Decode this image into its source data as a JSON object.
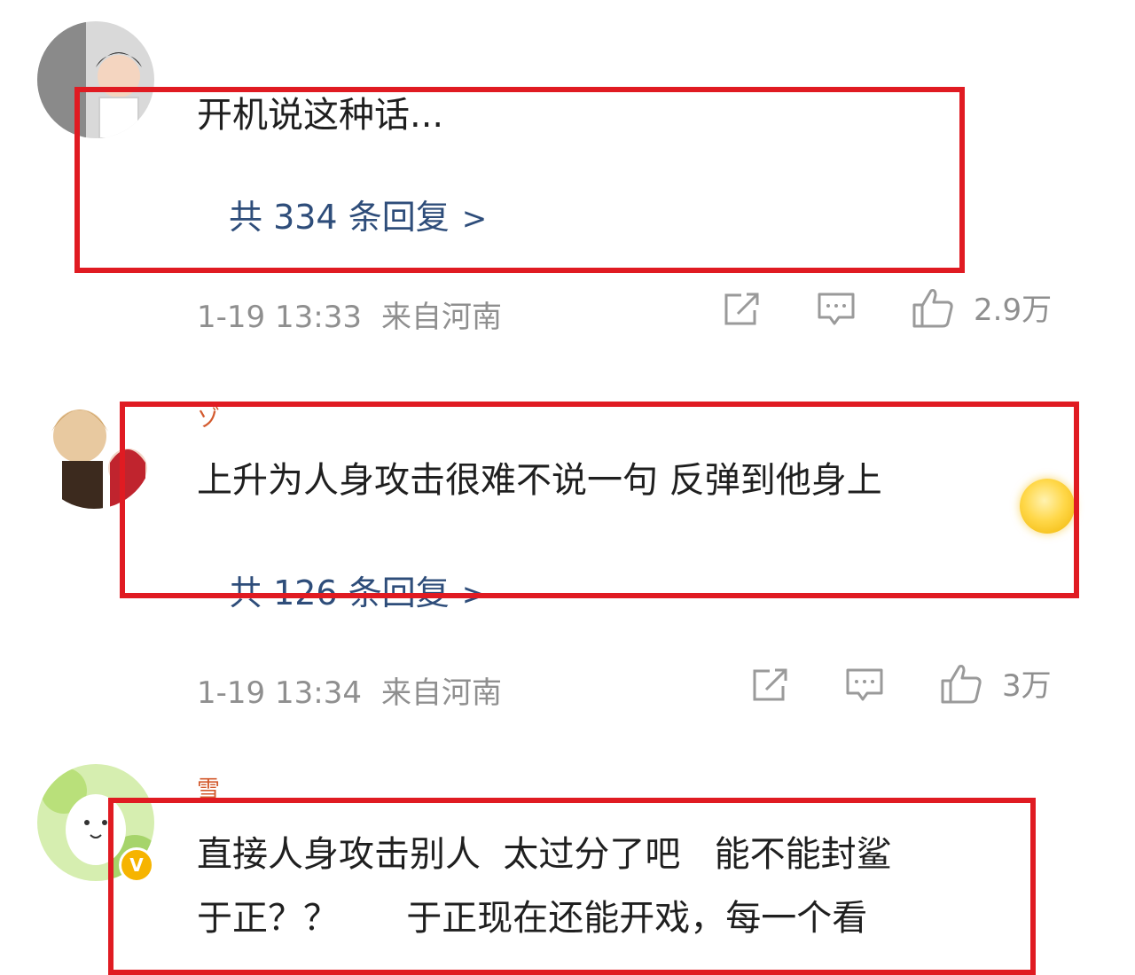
{
  "comments": [
    {
      "text": "开机说这种话...",
      "replies_label": "共 334 条回复",
      "time": "1-19 13:33",
      "location": "来自河南",
      "likes": "2.9万"
    },
    {
      "username": "ゾ",
      "text": "上升为人身攻击很难不说一句 反弹到他身上",
      "replies_label": "共 126 条回复",
      "time": "1-19 13:34",
      "location": "来自河南",
      "likes": "3万"
    },
    {
      "username": "雪",
      "text_line1": "直接人身攻击别人  太过分了吧   能不能封鲨",
      "text_line2": "于正？？      于正现在还能开戏，每一个看"
    }
  ],
  "icons": {
    "chevron": ">",
    "verified": "V"
  },
  "colors": {
    "highlight": "#e01b22",
    "reply_link": "#2e4d7a",
    "meta_text": "#8f8f8f",
    "body_text": "#1f1f1f"
  }
}
